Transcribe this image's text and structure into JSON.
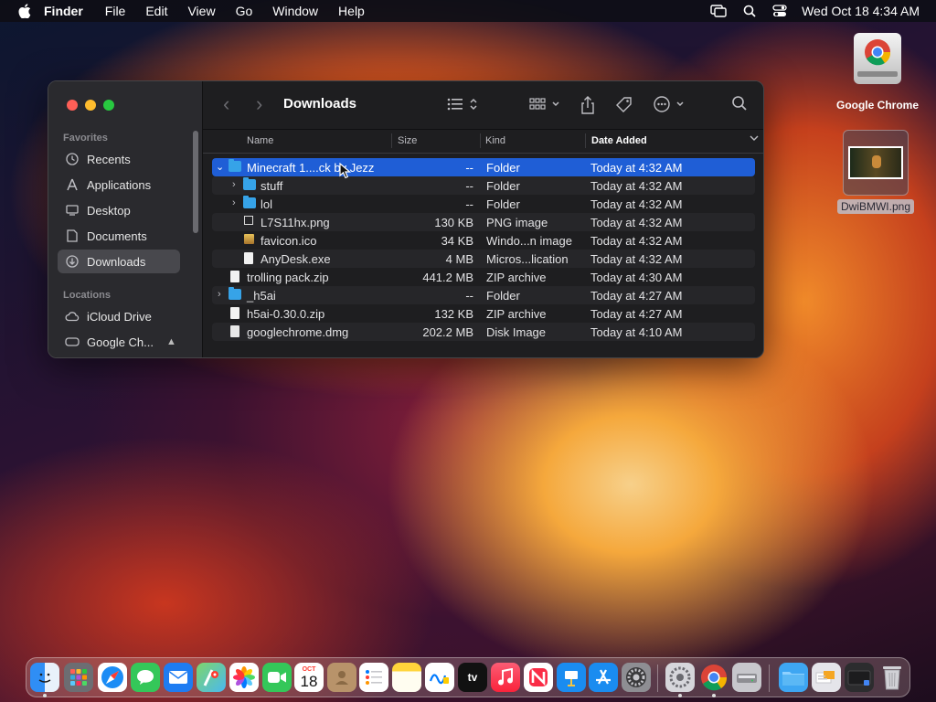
{
  "menubar": {
    "app_name": "Finder",
    "items": [
      "File",
      "Edit",
      "View",
      "Go",
      "Window",
      "Help"
    ],
    "clock": "Wed Oct 18  4:34 AM"
  },
  "desktop": {
    "chrome_drive_label": "Google Chrome",
    "png_file_label": "DwiBMWI.png"
  },
  "finder": {
    "title": "Downloads",
    "sidebar": {
      "favorites_heading": "Favorites",
      "favorites": [
        "Recents",
        "Applications",
        "Desktop",
        "Documents",
        "Downloads"
      ],
      "locations_heading": "Locations",
      "locations": [
        "iCloud Drive",
        "Google Ch..."
      ]
    },
    "columns": {
      "name": "Name",
      "size": "Size",
      "kind": "Kind",
      "date": "Date Added"
    },
    "rows": [
      {
        "name": "Minecraft 1....ck by Jezz",
        "size": "--",
        "kind": "Folder",
        "date": "Today at 4:32 AM"
      },
      {
        "name": "stuff",
        "size": "--",
        "kind": "Folder",
        "date": "Today at 4:32 AM"
      },
      {
        "name": "lol",
        "size": "--",
        "kind": "Folder",
        "date": "Today at 4:32 AM"
      },
      {
        "name": "L7S11hx.png",
        "size": "130 KB",
        "kind": "PNG image",
        "date": "Today at 4:32 AM"
      },
      {
        "name": "favicon.ico",
        "size": "34 KB",
        "kind": "Windo...n image",
        "date": "Today at 4:32 AM"
      },
      {
        "name": "AnyDesk.exe",
        "size": "4 MB",
        "kind": "Micros...lication",
        "date": "Today at 4:32 AM"
      },
      {
        "name": "trolling pack.zip",
        "size": "441.2 MB",
        "kind": "ZIP archive",
        "date": "Today at 4:30 AM"
      },
      {
        "name": "_h5ai",
        "size": "--",
        "kind": "Folder",
        "date": "Today at 4:27 AM"
      },
      {
        "name": "h5ai-0.30.0.zip",
        "size": "132 KB",
        "kind": "ZIP archive",
        "date": "Today at 4:27 AM"
      },
      {
        "name": "googlechrome.dmg",
        "size": "202.2 MB",
        "kind": "Disk Image",
        "date": "Today at 4:10 AM"
      }
    ]
  },
  "dock": {
    "calendar_month": "OCT",
    "calendar_day": "18",
    "tv_label": "tv"
  },
  "colors": {
    "selection": "#1f5ed6",
    "folder": "#36a3e8",
    "close": "#fe5f57",
    "minimize": "#febc2e",
    "maximize": "#28c840"
  }
}
